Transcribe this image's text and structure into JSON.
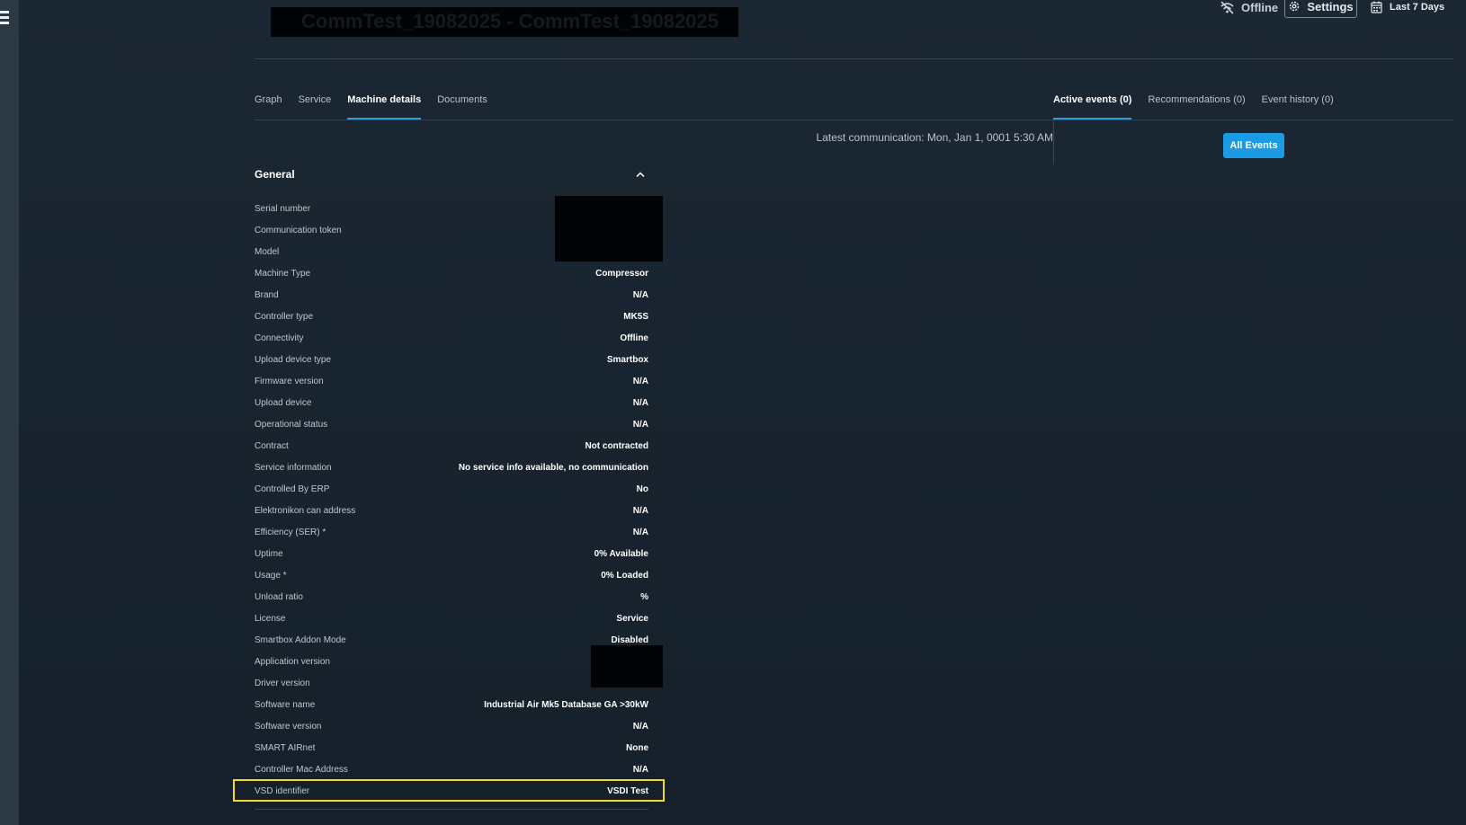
{
  "header": {
    "title": "CommTest_19082025 - CommTest_19082025",
    "status": "Offline",
    "settings_label": "Settings",
    "date_range_label": "Last 7 Days"
  },
  "tabs_left": [
    {
      "label": "Graph",
      "active": false
    },
    {
      "label": "Service",
      "active": false
    },
    {
      "label": "Machine details",
      "active": true
    },
    {
      "label": "Documents",
      "active": false
    }
  ],
  "tabs_right": [
    {
      "label": "Active events (0)",
      "active": true
    },
    {
      "label": "Recommendations (0)",
      "active": false
    },
    {
      "label": "Event history (0)",
      "active": false
    }
  ],
  "latest_communication": "Latest communication: Mon, Jan 1, 0001 5:30 AM",
  "all_events_label": "All Events",
  "general": {
    "title": "General",
    "rows": [
      {
        "label": "Serial number",
        "value": ""
      },
      {
        "label": "Communication token",
        "value": ""
      },
      {
        "label": "Model",
        "value": ""
      },
      {
        "label": "Machine Type",
        "value": "Compressor"
      },
      {
        "label": "Brand",
        "value": "N/A"
      },
      {
        "label": "Controller type",
        "value": "MK5S"
      },
      {
        "label": "Connectivity",
        "value": "Offline"
      },
      {
        "label": "Upload device type",
        "value": "Smartbox"
      },
      {
        "label": "Firmware version",
        "value": "N/A"
      },
      {
        "label": "Upload device",
        "value": "N/A"
      },
      {
        "label": "Operational status",
        "value": "N/A"
      },
      {
        "label": "Contract",
        "value": "Not contracted"
      },
      {
        "label": "Service information",
        "value": "No service info available, no communication"
      },
      {
        "label": "Controlled By ERP",
        "value": "No"
      },
      {
        "label": "Elektronikon can address",
        "value": "N/A"
      },
      {
        "label": "Efficiency (SER) *",
        "value": "N/A"
      },
      {
        "label": "Uptime",
        "value": "0% Available"
      },
      {
        "label": "Usage *",
        "value": "0% Loaded"
      },
      {
        "label": "Unload ratio",
        "value": "%"
      },
      {
        "label": "License",
        "value": "Service"
      },
      {
        "label": "Smartbox Addon Mode",
        "value": "Disabled"
      },
      {
        "label": "Application version",
        "value": ""
      },
      {
        "label": "Driver version",
        "value": ""
      },
      {
        "label": "Software name",
        "value": "Industrial Air Mk5 Database GA >30kW"
      },
      {
        "label": "Software version",
        "value": "N/A"
      },
      {
        "label": "SMART AIRnet",
        "value": "None"
      },
      {
        "label": "Controller Mac Address",
        "value": "N/A"
      },
      {
        "label": "VSD identifier",
        "value": "VSDI Test"
      }
    ]
  },
  "colors": {
    "background": "#182431",
    "accent": "#1a9be3",
    "highlight": "#f2db21"
  }
}
